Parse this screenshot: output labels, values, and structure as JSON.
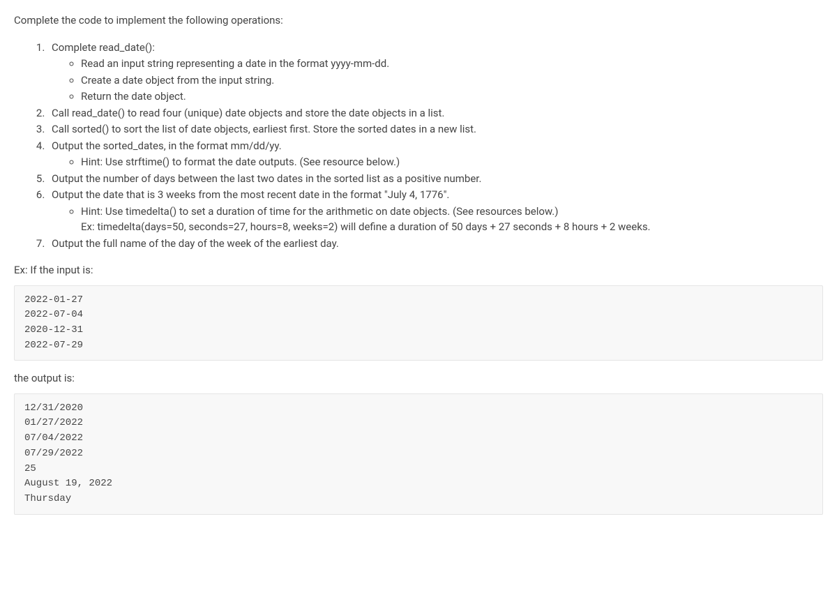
{
  "intro": "Complete the code to implement the following operations:",
  "steps": [
    {
      "text": "Complete read_date():",
      "sub": [
        "Read an input string representing a date in the format yyyy-mm-dd.",
        "Create a date object from the input string.",
        "Return the date object."
      ]
    },
    {
      "text": "Call read_date() to read four (unique) date objects and store the date objects in a list."
    },
    {
      "text": "Call sorted() to sort the list of date objects, earliest first. Store the sorted dates in a new list."
    },
    {
      "text": "Output the sorted_dates, in the format mm/dd/yy.",
      "sub": [
        "Hint: Use strftime() to format the date outputs. (See resource below.)"
      ]
    },
    {
      "text": "Output the number of days between the last two dates in the sorted list as a positive number."
    },
    {
      "text": "Output the date that is 3 weeks from the most recent date in the format \"July 4, 1776\".",
      "sub": [
        "Hint: Use timedelta() to set a duration of time for the arithmetic on date objects. (See resources below.)\nEx: timedelta(days=50, seconds=27, hours=8, weeks=2) will define a duration of 50 days + 27 seconds + 8 hours + 2 weeks."
      ]
    },
    {
      "text": "Output the full name of the day of the week of the earliest day."
    }
  ],
  "example_input_label": "Ex: If the input is:",
  "example_input": "2022-01-27\n2022-07-04\n2020-12-31\n2022-07-29",
  "example_output_label": "the output is:",
  "example_output": "12/31/2020\n01/27/2022\n07/04/2022\n07/29/2022\n25\nAugust 19, 2022\nThursday"
}
